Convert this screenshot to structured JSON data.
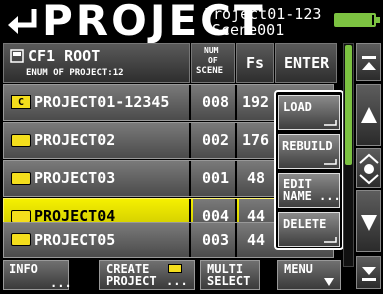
{
  "title_bar": {
    "title": "PROJECT",
    "project_name": "Project01-123",
    "scene_name": "Scene001"
  },
  "header": {
    "media": "CF1 ROOT",
    "project_count": "ENUM OF PROJECT:12",
    "num_scene_line1": "NUM",
    "num_scene_line2": "OF",
    "num_scene_line3": "SCENE",
    "fs": "Fs",
    "enter": "ENTER"
  },
  "rows": [
    {
      "name": "PROJECT01-12345",
      "scenes": "008",
      "fs": "192",
      "current": true
    },
    {
      "name": "PROJECT02",
      "scenes": "002",
      "fs": "176"
    },
    {
      "name": "PROJECT03",
      "scenes": "001",
      "fs": "48"
    },
    {
      "name": "PROJECT04",
      "scenes": "004",
      "fs": "44",
      "selected": true
    },
    {
      "name": "PROJECT05",
      "scenes": "003",
      "fs": "44"
    }
  ],
  "popup_menu": {
    "load": "LOAD",
    "rebuild": "REBUILD",
    "edit_line1": "EDIT",
    "edit_line2": "NAME",
    "delete": "DELETE"
  },
  "footer": {
    "info": "INFO",
    "create_line1": "CREATE",
    "create_line2": "PROJECT",
    "multi_line1": "MULTI",
    "multi_line2": "SELECT",
    "menu": "MENU"
  },
  "colors": {
    "selected_row": "#f0ec00",
    "folder": "#f4de1c",
    "battery": "#7cc241",
    "background": "#000000"
  }
}
